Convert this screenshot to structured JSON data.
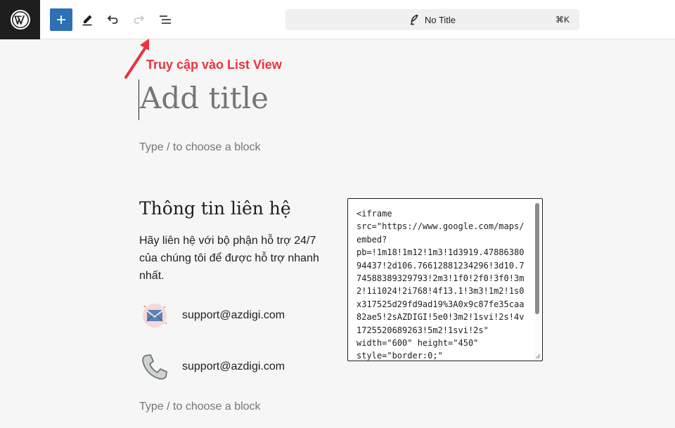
{
  "toolbar": {
    "logo_icon": "wordpress-icon",
    "add_icon": "plus-icon",
    "edit_icon": "pencil-icon",
    "undo_icon": "undo-icon",
    "redo_icon": "redo-icon",
    "list_view_icon": "list-view-icon",
    "command": {
      "icon": "feather-icon",
      "title": "No Title",
      "shortcut": "⌘K"
    },
    "accent_color": "#2f6fb4"
  },
  "annotation": {
    "text": "Truy cập vào List View",
    "color": "#e8343f"
  },
  "editor": {
    "title_placeholder": "Add title",
    "block_hint_1": "Type / to choose a block",
    "contact_heading": "Thông tin liên hệ",
    "contact_description": "Hãy liên hệ với bộ phận hỗ trợ 24/7 của chúng tôi để được hỗ trợ nhanh nhất.",
    "contacts": [
      {
        "icon": "envelope-icon",
        "text": "support@azdigi.com"
      },
      {
        "icon": "phone-icon",
        "text": "support@azdigi.com"
      }
    ],
    "html_code": "<iframe\nsrc=\"https://www.google.com/maps/\nembed?\npb=!1m18!1m12!1m3!1d3919.47886380\n94437!2d106.76612881234296!3d10.7\n74588389329793!2m3!1f0!2f0!3f0!3m\n2!1i1024!2i768!4f13.1!3m3!1m2!1s0\nx317525d29fd9ad19%3A0x9c87fe35caa\n82ae5!2sAZDIGI!5e0!3m2!1svi!2s!4v\n1725520689263!5m2!1svi!2s\"\nwidth=\"600\" height=\"450\"\nstyle=\"border:0;\"",
    "block_hint_2": "Type / to choose a block"
  }
}
